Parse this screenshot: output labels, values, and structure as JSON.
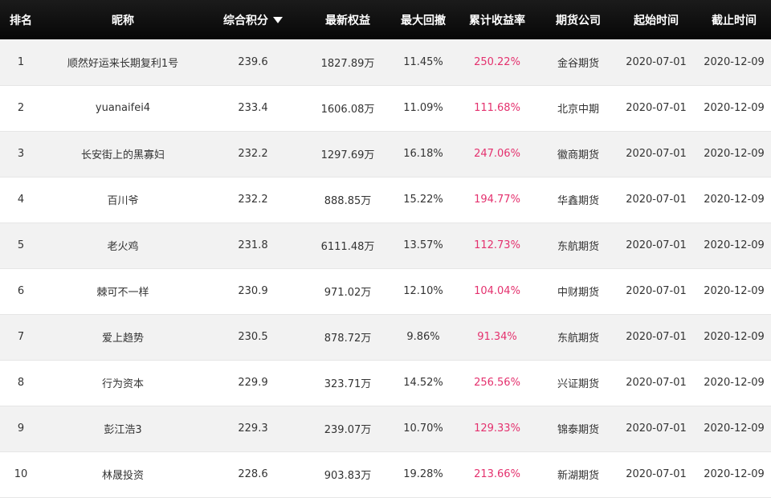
{
  "colors": {
    "header_bg": "#0b0b0b",
    "header_text": "#ffffff",
    "row_alt_bg": "#f2f2f2",
    "return_text": "#e4316e"
  },
  "header": {
    "rank": "排名",
    "nickname": "昵称",
    "score": "综合积分",
    "score_sort_icon": "sort-desc-triangle-icon",
    "equity": "最新权益",
    "drawdown": "最大回撤",
    "return": "累计收益率",
    "company": "期货公司",
    "start": "起始时间",
    "end": "截止时间"
  },
  "rows": [
    {
      "rank": "1",
      "nickname": "顺然好运来长期复利1号",
      "score": "239.6",
      "equity": "1827.89万",
      "drawdown": "11.45%",
      "return": "250.22%",
      "company": "金谷期货",
      "start": "2020-07-01",
      "end": "2020-12-09"
    },
    {
      "rank": "2",
      "nickname": "yuanaifei4",
      "score": "233.4",
      "equity": "1606.08万",
      "drawdown": "11.09%",
      "return": "111.68%",
      "company": "北京中期",
      "start": "2020-07-01",
      "end": "2020-12-09"
    },
    {
      "rank": "3",
      "nickname": "长安街上的黑寡妇",
      "score": "232.2",
      "equity": "1297.69万",
      "drawdown": "16.18%",
      "return": "247.06%",
      "company": "徽商期货",
      "start": "2020-07-01",
      "end": "2020-12-09"
    },
    {
      "rank": "4",
      "nickname": "百川爷",
      "score": "232.2",
      "equity": "888.85万",
      "drawdown": "15.22%",
      "return": "194.77%",
      "company": "华鑫期货",
      "start": "2020-07-01",
      "end": "2020-12-09"
    },
    {
      "rank": "5",
      "nickname": "老火鸡",
      "score": "231.8",
      "equity": "6111.48万",
      "drawdown": "13.57%",
      "return": "112.73%",
      "company": "东航期货",
      "start": "2020-07-01",
      "end": "2020-12-09"
    },
    {
      "rank": "6",
      "nickname": "棘可不一样",
      "score": "230.9",
      "equity": "971.02万",
      "drawdown": "12.10%",
      "return": "104.04%",
      "company": "中财期货",
      "start": "2020-07-01",
      "end": "2020-12-09"
    },
    {
      "rank": "7",
      "nickname": "爱上趋势",
      "score": "230.5",
      "equity": "878.72万",
      "drawdown": "9.86%",
      "return": "91.34%",
      "company": "东航期货",
      "start": "2020-07-01",
      "end": "2020-12-09"
    },
    {
      "rank": "8",
      "nickname": "行为资本",
      "score": "229.9",
      "equity": "323.71万",
      "drawdown": "14.52%",
      "return": "256.56%",
      "company": "兴证期货",
      "start": "2020-07-01",
      "end": "2020-12-09"
    },
    {
      "rank": "9",
      "nickname": "彭江浩3",
      "score": "229.3",
      "equity": "239.07万",
      "drawdown": "10.70%",
      "return": "129.33%",
      "company": "锦泰期货",
      "start": "2020-07-01",
      "end": "2020-12-09"
    },
    {
      "rank": "10",
      "nickname": "林晟投资",
      "score": "228.6",
      "equity": "903.83万",
      "drawdown": "19.28%",
      "return": "213.66%",
      "company": "新湖期货",
      "start": "2020-07-01",
      "end": "2020-12-09"
    }
  ]
}
